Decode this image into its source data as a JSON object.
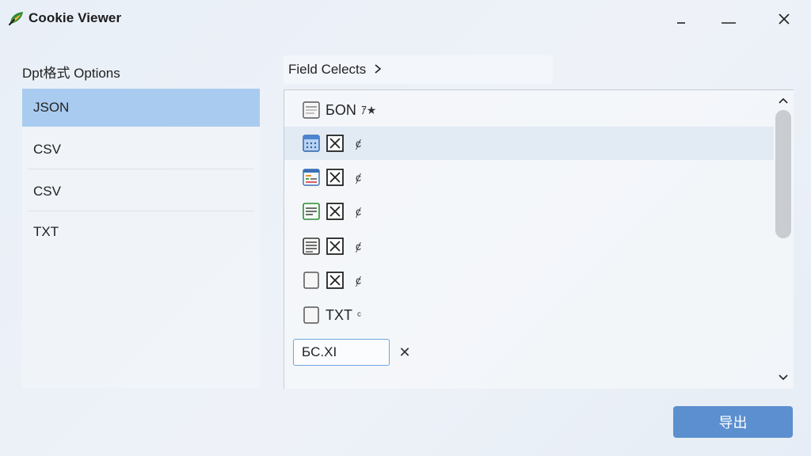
{
  "window": {
    "title": "Cookie Viewer",
    "controls": [
      "minimize",
      "maximize",
      "close"
    ]
  },
  "format_panel": {
    "title": "Dpt格式 Options",
    "items": [
      {
        "label": "JSON",
        "selected": true
      },
      {
        "label": "CSV",
        "selected": false
      },
      {
        "label": "CSV",
        "selected": false
      },
      {
        "label": "TXT",
        "selected": false
      }
    ]
  },
  "field_panel": {
    "breadcrumb": "Field Celects",
    "rows": [
      {
        "icon": "document-icon",
        "label": "БON",
        "suffix": "ｱ★"
      },
      {
        "icon": "blue-table-icon",
        "checkbox": "crossed-box-icon",
        "suffix": "ȼ",
        "highlighted": true
      },
      {
        "icon": "color-list-icon",
        "checkbox": "crossed-box-icon",
        "suffix": "ȼ"
      },
      {
        "icon": "green-list-icon",
        "checkbox": "crossed-box-icon",
        "suffix": "ȼ"
      },
      {
        "icon": "document-lines-icon",
        "checkbox": "crossed-box-icon",
        "suffix": "ȼ"
      },
      {
        "icon": "blank-page-icon",
        "checkbox": "crossed-box-icon",
        "suffix": "ȼ"
      },
      {
        "icon": "blank-page-icon",
        "label": "TXT",
        "suffix": "ᶜ"
      }
    ],
    "edit_value": "БC.XI",
    "clear_symbol": "✕"
  },
  "footer": {
    "export_label": "导出"
  },
  "colors": {
    "accent": "#5b8fcf",
    "selection": "#a9cbef",
    "row_highlight": "#e2eaf4"
  }
}
